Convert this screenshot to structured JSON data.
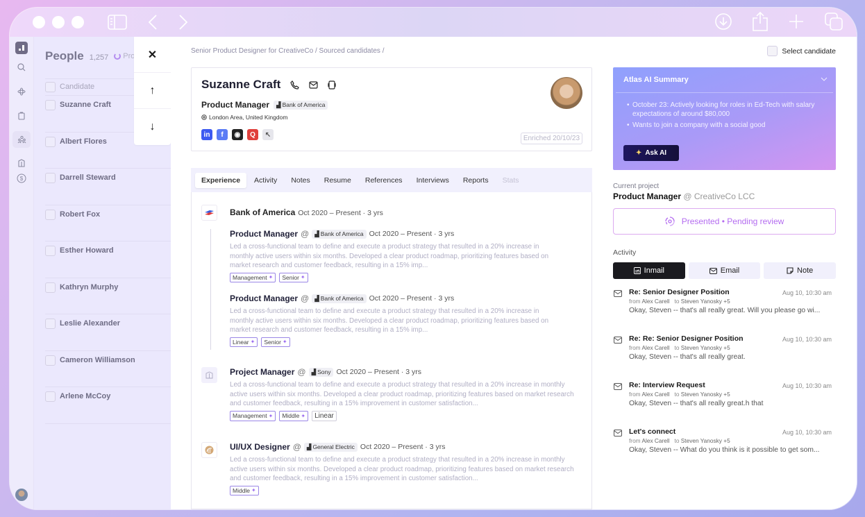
{
  "titlebar": {
    "icons": [
      "sidebar-toggle-icon",
      "back-icon",
      "forward-icon",
      "download-icon",
      "share-icon",
      "new-tab-icon",
      "tabs-icon"
    ]
  },
  "rail": {
    "items": [
      "logo",
      "search-icon",
      "integrations-icon",
      "clipboard-icon",
      "people-icon",
      "companies-icon",
      "billing-icon"
    ]
  },
  "people": {
    "title": "People",
    "count": "1,257",
    "pro_label": "Pro",
    "header": "Candidate",
    "candidates": [
      "Suzanne Craft",
      "Albert Flores",
      "Darrell Steward",
      "Robert Fox",
      "Esther Howard",
      "Kathryn Murphy",
      "Leslie Alexander",
      "Cameron Williamson",
      "Arlene McCoy"
    ]
  },
  "nav": {
    "close": "✕",
    "up": "↑",
    "down": "↓"
  },
  "breadcrumb": "Senior Product Designer for CreativeCo / Sourced candidates /",
  "select_candidate": "Select candidate",
  "profile": {
    "name": "Suzanne Craft",
    "role": "Product Manager",
    "company": "Bank of America",
    "location": "London Area, United Kingdom",
    "socials": [
      {
        "name": "linkedin",
        "label": "in",
        "color": "#3d5af1"
      },
      {
        "name": "facebook",
        "label": "f",
        "color": "#5b7cf5"
      },
      {
        "name": "github",
        "label": "◉",
        "color": "#222222"
      },
      {
        "name": "quora",
        "label": "Q",
        "color": "#e0403c"
      },
      {
        "name": "website",
        "label": "↖",
        "color": "#e6e6ec"
      }
    ],
    "enriched": "Enriched 20/10/23"
  },
  "tabs": [
    {
      "label": "Experience",
      "active": true
    },
    {
      "label": "Activity"
    },
    {
      "label": "Notes"
    },
    {
      "label": "Resume"
    },
    {
      "label": "References"
    },
    {
      "label": "Interviews"
    },
    {
      "label": "Reports"
    },
    {
      "label": "Stats",
      "disabled": true
    }
  ],
  "experience": {
    "company_group": {
      "name": "Bank of America",
      "dates": "Oct 2020 – Present · 3 yrs"
    },
    "roles": [
      {
        "title": "Product Manager",
        "at": "@",
        "company": "Bank of America",
        "dates": "Oct 2020 – Present · 3 yrs",
        "desc": "Led a cross-functional team to define and execute a product strategy that resulted in a 20% increase in monthly active users within six months. Developed a clear product roadmap, prioritizing features based on market research and customer feedback, resulting in a 15% imp...",
        "tags": [
          "Management",
          "Senior"
        ]
      },
      {
        "title": "Product Manager",
        "at": "@",
        "company": "Bank of America",
        "dates": "Oct 2020 – Present · 3 yrs",
        "desc": "Led a cross-functional team to define and execute a product strategy that resulted in a 20% increase in monthly active users within six months. Developed a clear product roadmap, prioritizing features based on market research and customer feedback, resulting in a 15% imp...",
        "tags": [
          "Linear",
          "Senior"
        ]
      },
      {
        "title": "Project Manager",
        "at": "@",
        "company": "Sony",
        "dates": "Oct 2020 – Present · 3 yrs",
        "desc": "Led a cross-functional team to define and execute a product strategy that resulted in a 20% increase in monthly active users within six months. Developed a clear product roadmap, prioritizing features based on market research and customer feedback, resulting in a 15% improvement in customer satisfaction...",
        "tags": [
          "Management",
          "Middle"
        ],
        "plain_tag": "Linear"
      },
      {
        "title": "UI/UX Designer",
        "at": "@",
        "company": "General Electric",
        "dates": "Oct 2020 – Present · 3 yrs",
        "desc": "Led a cross-functional team to define and execute a product strategy that resulted in a 20% increase in monthly active users within six months. Developed a clear product roadmap, prioritizing features based on market research and customer feedback, resulting in a 15% improvement in customer satisfaction...",
        "tags": [
          "Middle"
        ]
      }
    ]
  },
  "ai_summary": {
    "title": "Atlas AI Summary",
    "bullets": [
      "October 23: Actively looking for roles in Ed-Tech with salary expectations of around $80,000",
      "Wants to join a company with a social good"
    ],
    "ask_label": "Ask AI"
  },
  "current_project": {
    "label": "Current project",
    "role": "Product Manager",
    "company": "@ CreativeCo LCC",
    "status": "Presented • Pending review"
  },
  "activity": {
    "label": "Activity",
    "buttons": [
      {
        "label": "Inmail",
        "active": true
      },
      {
        "label": "Email"
      },
      {
        "label": "Note"
      }
    ],
    "messages": [
      {
        "subject": "Re: Senior Designer Position",
        "date": "Aug 10, 10:30 am",
        "from": "Alex Carell",
        "to": "Steven Yanosky +5",
        "body": "Okay, Steven -- that's all really great. Will you please go wi..."
      },
      {
        "subject": "Re: Re: Senior Designer Position",
        "date": "Aug 10, 10:30 am",
        "from": "Alex Carell",
        "to": "Steven Yanosky +5",
        "body": "Okay, Steven -- that's all really great."
      },
      {
        "subject": "Re: Interview Request",
        "date": "Aug 10, 10:30 am",
        "from": "Alex Carell",
        "to": "Steven Yanosky +5",
        "body": "Okay, Steven -- that's all really great.h that"
      },
      {
        "subject": "Let's connect",
        "date": "Aug 10, 10:30 am",
        "from": "Alex Carell",
        "to": "Steven Yanosky +5",
        "body": "Okay, Steven -- What do you think is it possible to get som..."
      }
    ],
    "from_prefix": "from",
    "to_prefix": "to"
  }
}
